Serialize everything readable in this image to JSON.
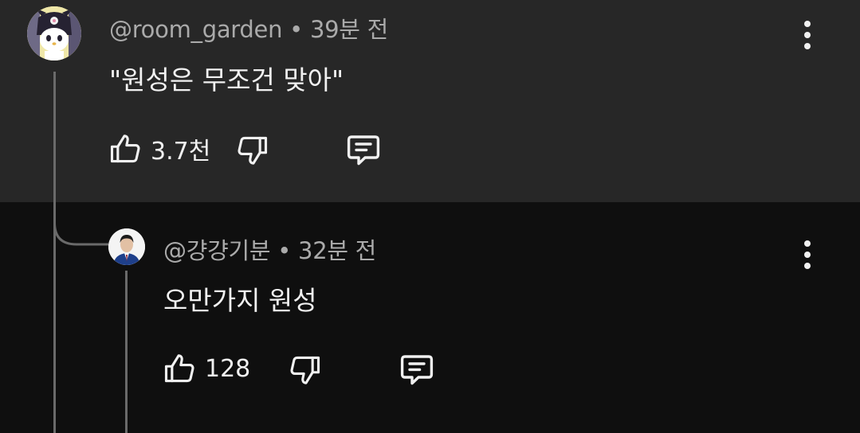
{
  "comments": [
    {
      "handle": "@room_garden",
      "separator": "•",
      "time": "39분 전",
      "text": "\"원성은 무조건 맞아\"",
      "like_count": "3.7천",
      "avatar_icon": "kuromi-avatar-icon"
    },
    {
      "handle": "@걍걍기분",
      "separator": "•",
      "time": "32분 전",
      "text": "오만가지 원성",
      "like_count": "128",
      "avatar_icon": "person-suit-avatar-icon"
    }
  ],
  "colors": {
    "top_comment_bg": "#272727",
    "reply_bg": "#0f0f0f",
    "meta_text": "#aaaaaa",
    "main_text": "#f1f1f1",
    "thread_line": "#6a6a6a"
  }
}
